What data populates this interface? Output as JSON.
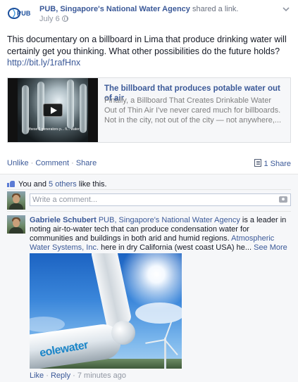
{
  "post": {
    "author": "PUB, Singapore's National Water Agency",
    "action": " shared a link.",
    "timestamp": "July 6",
    "logo_text": "PUB",
    "message": "This documentary on a billboard in Lima that produce drinking water will certainly get you thinking. What other possibilities do the future holds?",
    "url": "http://bit.ly/1rafHnx"
  },
  "link_preview": {
    "title": "The billboard that produces potable water out of air",
    "description": "Finally, a Billboard That Creates Drinkable Water Out of Thin Air I've never cared much for billboards. Not in the city, not out of the city — not anywhere,...",
    "thumbnail_caption": "these 5 generators p... fi... water"
  },
  "actions": {
    "unlike": "Unlike",
    "sep1": " · ",
    "comment": "Comment",
    "sep2": " · ",
    "share": "Share",
    "share_count": "1 Share"
  },
  "likes": {
    "prefix": "You and ",
    "others": "5 others",
    "suffix": " like this."
  },
  "comment_box": {
    "placeholder": "Write a comment..."
  },
  "comment": {
    "author": "Gabriele Schubert",
    "mention1": "PUB, Singapore's National Water Agency",
    "text1": " is a leader in noting air-to-water tech that can produce condensation water for communities and buildings in both arid and humid regions. ",
    "mention2": "Atmospheric Water Systems, Inc.",
    "text2": " here in dry California (west coast USA) he... ",
    "see_more": "See More",
    "photo_brand": "eolewater",
    "like": "Like",
    "sep": " · ",
    "reply": "Reply",
    "sep2": " · ",
    "time": "7 minutes ago"
  },
  "colors": {
    "link": "#3b5998",
    "muted": "#9197a3",
    "background_ufi": "#f6f7f9"
  },
  "icons": [
    "globe-icon",
    "chevron-down-icon",
    "play-icon",
    "share-icon",
    "like-thumb-icon",
    "camera-icon"
  ]
}
